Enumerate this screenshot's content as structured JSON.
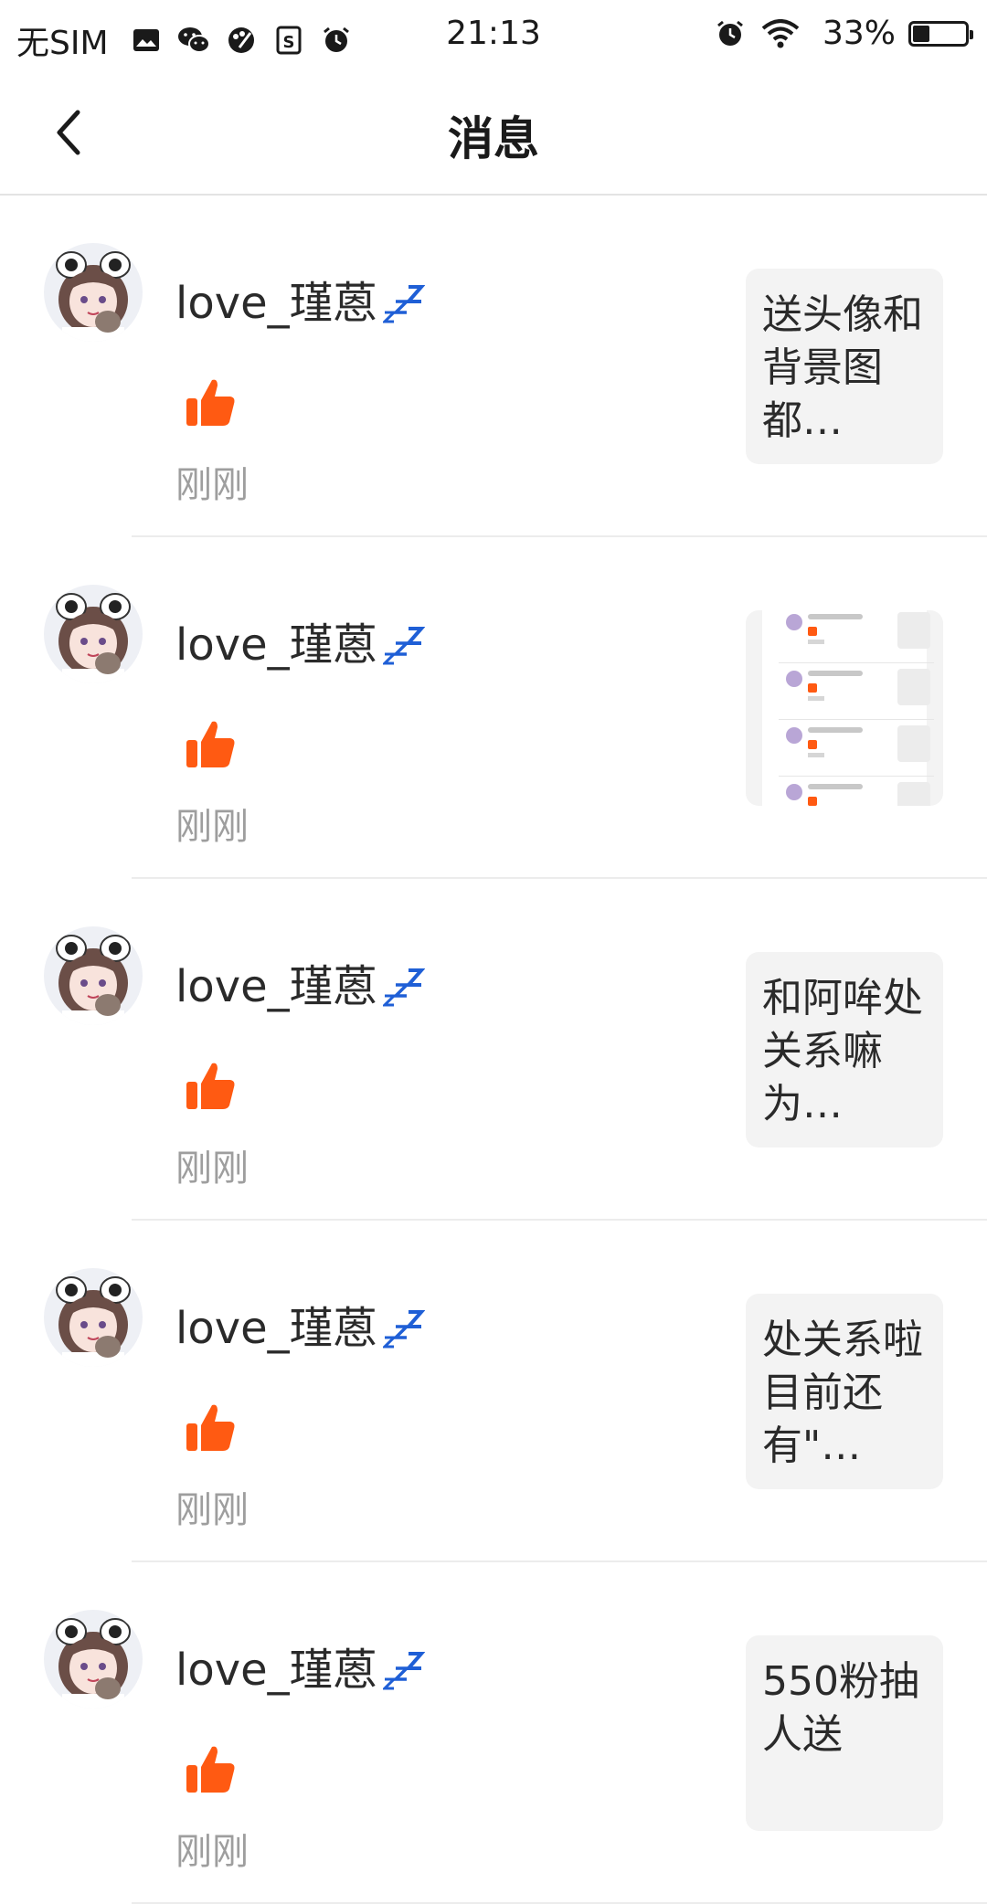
{
  "status_bar": {
    "carrier": "无SIM",
    "time": "21:13",
    "battery_percent": "33%",
    "battery_level": 0.33,
    "left_icons": [
      "gallery-icon",
      "wechat-icon",
      "paint-icon",
      "s-app-icon",
      "alarm-icon"
    ],
    "right_icons": [
      "alarm-icon",
      "wifi-icon",
      "battery-icon"
    ]
  },
  "nav": {
    "back_icon": "chevron-left-icon",
    "title": "消息"
  },
  "colors": {
    "like": "#ff5a12",
    "zzz": "#1f5fd6",
    "time_text": "#9e9e9e",
    "thumb_bg": "#f3f3f3"
  },
  "items": [
    {
      "username": "love_瑾蒽",
      "time": "刚刚",
      "preview_type": "text",
      "preview_text": "送头像和背景图都…"
    },
    {
      "username": "love_瑾蒽",
      "time": "刚刚",
      "preview_type": "image",
      "preview_text": ""
    },
    {
      "username": "love_瑾蒽",
      "time": "刚刚",
      "preview_type": "text",
      "preview_text": "和阿哞处关系嘛为…"
    },
    {
      "username": "love_瑾蒽",
      "time": "刚刚",
      "preview_type": "text",
      "preview_text": "处关系啦目前还有\"…"
    },
    {
      "username": "love_瑾蒽",
      "time": "刚刚",
      "preview_type": "text",
      "preview_text": "550粉抽人送"
    }
  ]
}
